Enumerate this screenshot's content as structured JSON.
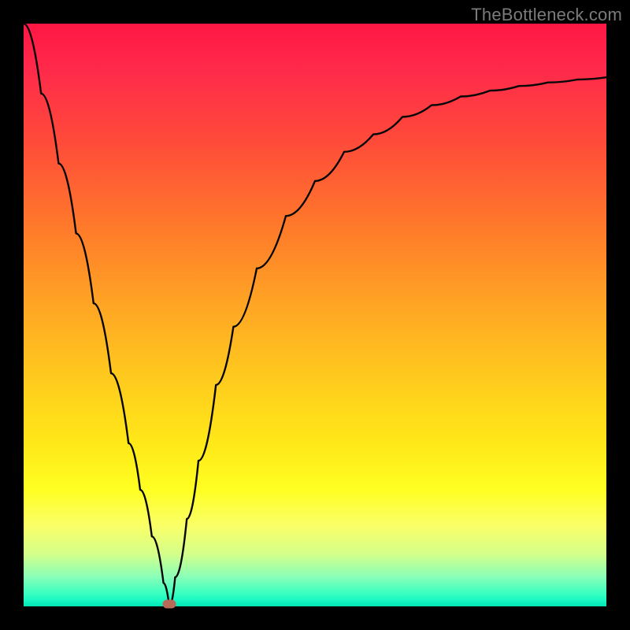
{
  "watermark": "TheBottleneck.com",
  "colors": {
    "background": "#000000",
    "curve": "#070707",
    "marker": "#b86a58",
    "gradient_top": "#ff1744",
    "gradient_bottom": "#00e5b4"
  },
  "chart_data": {
    "type": "line",
    "title": "",
    "xlabel": "",
    "ylabel": "",
    "xlim": [
      0,
      1
    ],
    "ylim": [
      0,
      1
    ],
    "note": "Axes are unlabeled; x and y are normalized 0–1 across the plot area. y=1 is the top (red) edge, y=0 is the bottom (green) edge.",
    "series": [
      {
        "name": "curve",
        "x": [
          0.0,
          0.03,
          0.06,
          0.09,
          0.12,
          0.15,
          0.18,
          0.2,
          0.22,
          0.24,
          0.25,
          0.26,
          0.28,
          0.3,
          0.33,
          0.36,
          0.4,
          0.45,
          0.5,
          0.55,
          0.6,
          0.65,
          0.7,
          0.75,
          0.8,
          0.85,
          0.9,
          0.95,
          1.0
        ],
        "y": [
          1.0,
          0.88,
          0.76,
          0.64,
          0.52,
          0.4,
          0.28,
          0.2,
          0.12,
          0.04,
          0.0,
          0.05,
          0.15,
          0.25,
          0.38,
          0.48,
          0.58,
          0.67,
          0.73,
          0.78,
          0.81,
          0.84,
          0.86,
          0.875,
          0.885,
          0.893,
          0.899,
          0.904,
          0.908
        ]
      }
    ],
    "marker": {
      "x": 0.25,
      "y": 0.0
    },
    "background_gradient": {
      "orientation": "vertical",
      "stops": [
        {
          "pos": 0.0,
          "color": "#ff1744"
        },
        {
          "pos": 0.35,
          "color": "#ff7a2a"
        },
        {
          "pos": 0.6,
          "color": "#ffc81e"
        },
        {
          "pos": 0.8,
          "color": "#ffff22"
        },
        {
          "pos": 0.95,
          "color": "#88ffb8"
        },
        {
          "pos": 1.0,
          "color": "#00e5b4"
        }
      ]
    }
  }
}
